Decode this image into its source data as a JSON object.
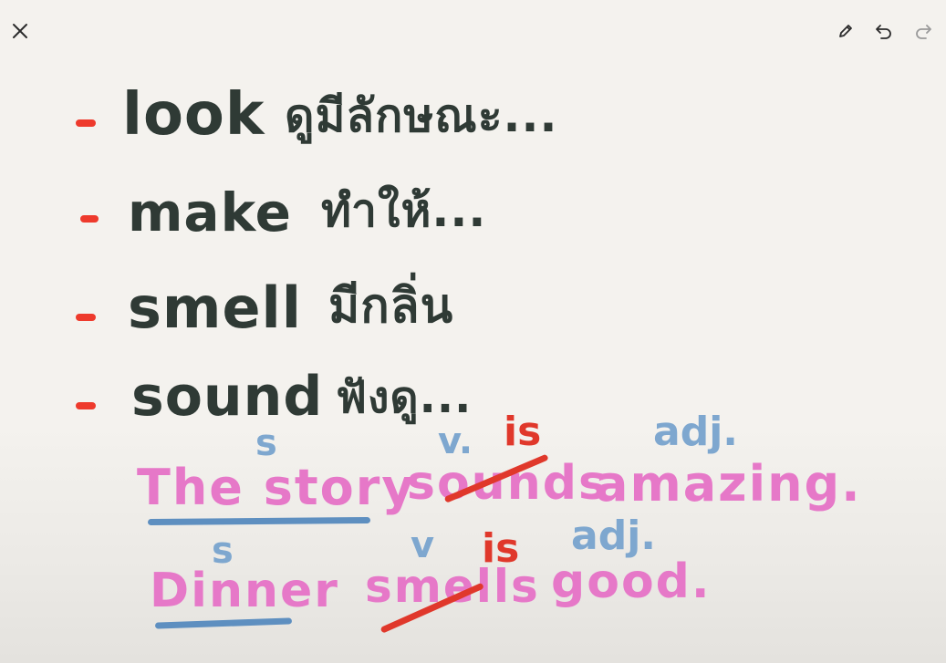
{
  "toolbar": {
    "close_icon": "close-icon",
    "pencil_icon": "pencil-icon",
    "undo_icon": "undo-icon",
    "redo_icon": "redo-icon"
  },
  "colors": {
    "ink_dark": "#2f3a35",
    "ink_pink": "#e678c8",
    "ink_blue": "#7ea7cf",
    "ink_red": "#e0382b",
    "background": "#f4f2ee"
  },
  "vocab": [
    {
      "bullet": "-",
      "en": "look",
      "th": "ดูมีลักษณะ..."
    },
    {
      "bullet": "-",
      "en": "make",
      "th": "ทำให้..."
    },
    {
      "bullet": "-",
      "en": "smell",
      "th": "มีกลิ่น"
    },
    {
      "bullet": "-",
      "en": "sound",
      "th": "ฟังดู..."
    }
  ],
  "examples": [
    {
      "subject": "The story",
      "verb": "sounds",
      "complement": "amazing.",
      "label_s": "s",
      "label_v": "v.",
      "label_adj": "adj.",
      "replacement": "is"
    },
    {
      "subject": "Dinner",
      "verb": "smells",
      "complement": "good.",
      "label_s": "s",
      "label_v": "v",
      "label_adj": "adj.",
      "replacement": "is"
    }
  ]
}
